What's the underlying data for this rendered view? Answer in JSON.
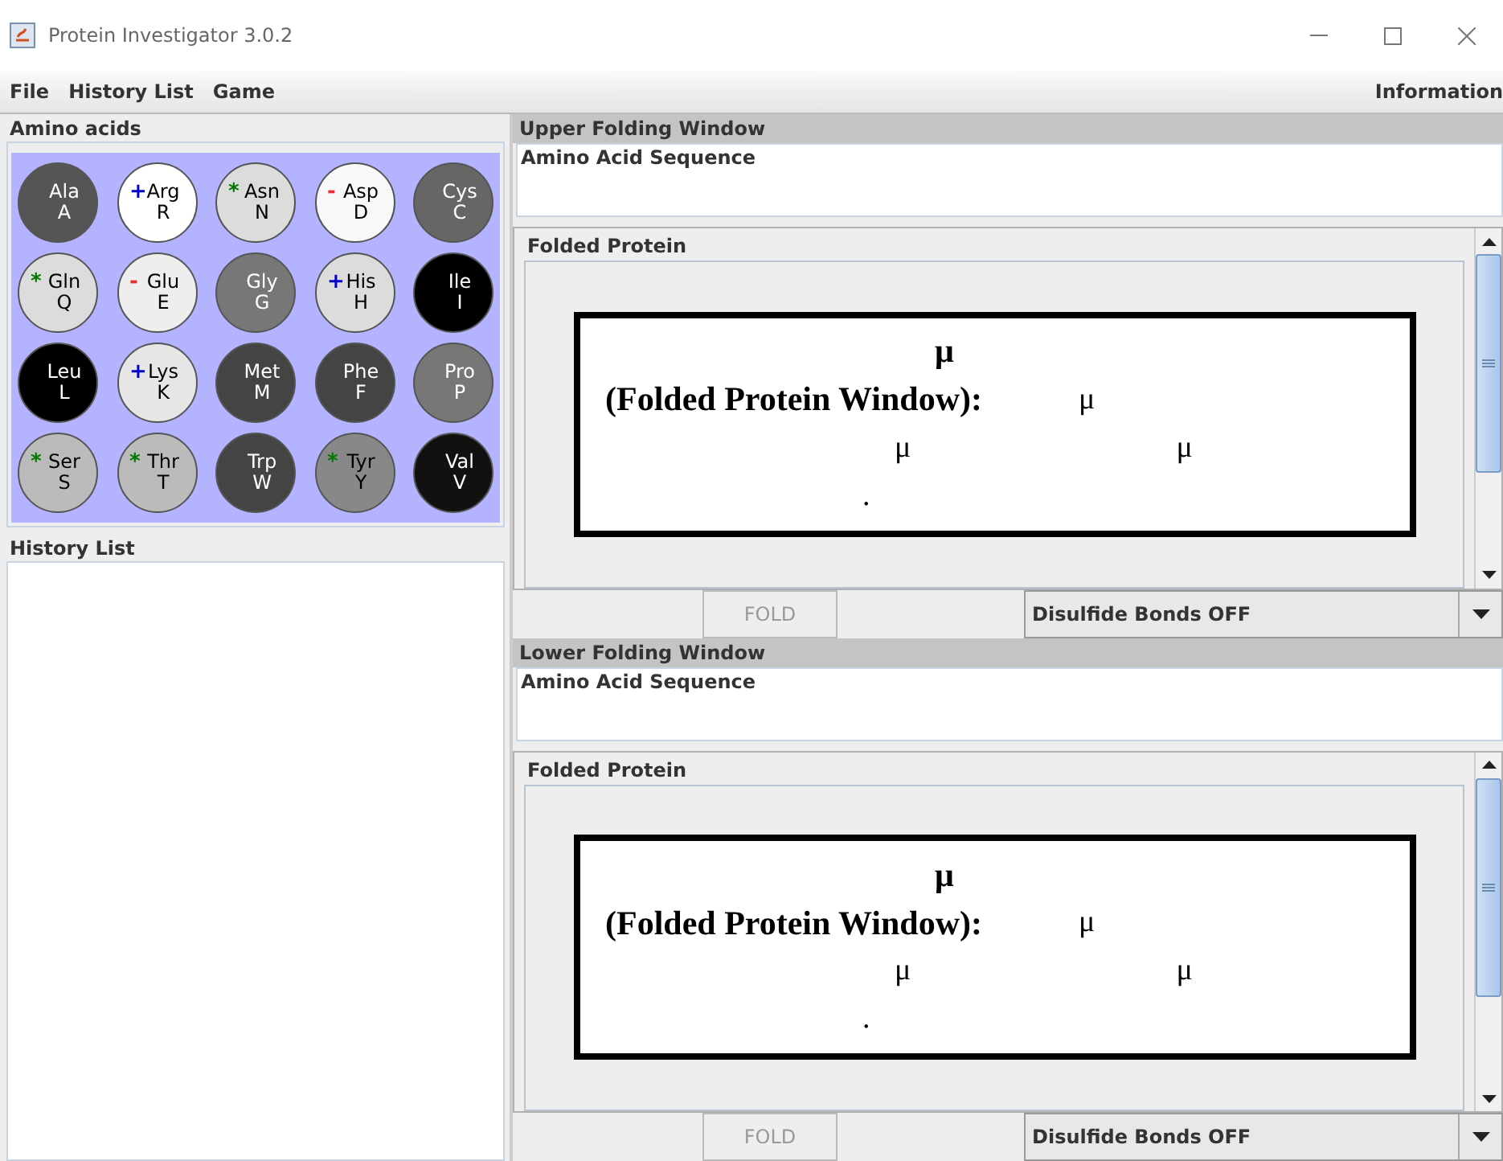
{
  "window": {
    "title": "Protein Investigator 3.0.2"
  },
  "menu": [
    "File",
    "History List",
    "Game"
  ],
  "menu_right": "Information",
  "amino_acids": {
    "title": "Amino acids",
    "items": [
      {
        "name": "Ala",
        "letter": "A",
        "color": "#555555"
      },
      {
        "name": "Arg",
        "letter": "R",
        "color": "#ffffff",
        "mark": "+",
        "kind": "positive"
      },
      {
        "name": "Asn",
        "letter": "N",
        "color": "#dcdcdc",
        "mark": "*",
        "kind": "polar"
      },
      {
        "name": "Asp",
        "letter": "D",
        "color": "#f8f8f8",
        "mark": "-",
        "kind": "negative"
      },
      {
        "name": "Cys",
        "letter": "C",
        "color": "#666666"
      },
      {
        "name": "Gln",
        "letter": "Q",
        "color": "#dcdcdc",
        "mark": "*",
        "kind": "polar"
      },
      {
        "name": "Glu",
        "letter": "E",
        "color": "#eeeeee",
        "mark": "-",
        "kind": "negative"
      },
      {
        "name": "Gly",
        "letter": "G",
        "color": "#777777"
      },
      {
        "name": "His",
        "letter": "H",
        "color": "#dcdcdc",
        "mark": "+",
        "kind": "positive"
      },
      {
        "name": "Ile",
        "letter": "I",
        "color": "#000000"
      },
      {
        "name": "Leu",
        "letter": "L",
        "color": "#000000"
      },
      {
        "name": "Lys",
        "letter": "K",
        "color": "#e6e6e6",
        "mark": "+",
        "kind": "positive"
      },
      {
        "name": "Met",
        "letter": "M",
        "color": "#444444"
      },
      {
        "name": "Phe",
        "letter": "F",
        "color": "#444444"
      },
      {
        "name": "Pro",
        "letter": "P",
        "color": "#777777"
      },
      {
        "name": "Ser",
        "letter": "S",
        "color": "#bbbbbb",
        "mark": "*",
        "kind": "polar"
      },
      {
        "name": "Thr",
        "letter": "T",
        "color": "#bbbbbb",
        "mark": "*",
        "kind": "polar"
      },
      {
        "name": "Trp",
        "letter": "W",
        "color": "#444444"
      },
      {
        "name": "Tyr",
        "letter": "Y",
        "color": "#888888",
        "mark": "*",
        "kind": "polar"
      },
      {
        "name": "Val",
        "letter": "V",
        "color": "#111111"
      }
    ]
  },
  "history_list": {
    "title": "History List"
  },
  "folding_windows": [
    {
      "title": "Upper Folding Window",
      "sequence_label": "Amino Acid Sequence",
      "folded_label": "Folded Protein",
      "lines": [
        [
          "μ"
        ],
        [
          "(Folded Protein Window):",
          "μ"
        ],
        [
          "μ",
          "μ"
        ],
        [
          "."
        ]
      ],
      "fold_button": {
        "label": "FOLD",
        "disabled": true
      },
      "disulfide": "Disulfide Bonds OFF"
    },
    {
      "title": "Lower Folding Window",
      "sequence_label": "Amino Acid Sequence",
      "folded_label": "Folded Protein",
      "lines": [
        [
          "μ"
        ],
        [
          "(Folded Protein Window):",
          "μ"
        ],
        [
          "μ",
          "μ"
        ],
        [
          "."
        ]
      ],
      "fold_button": {
        "label": "FOLD",
        "disabled": true
      },
      "disulfide": "Disulfide Bonds OFF"
    }
  ]
}
